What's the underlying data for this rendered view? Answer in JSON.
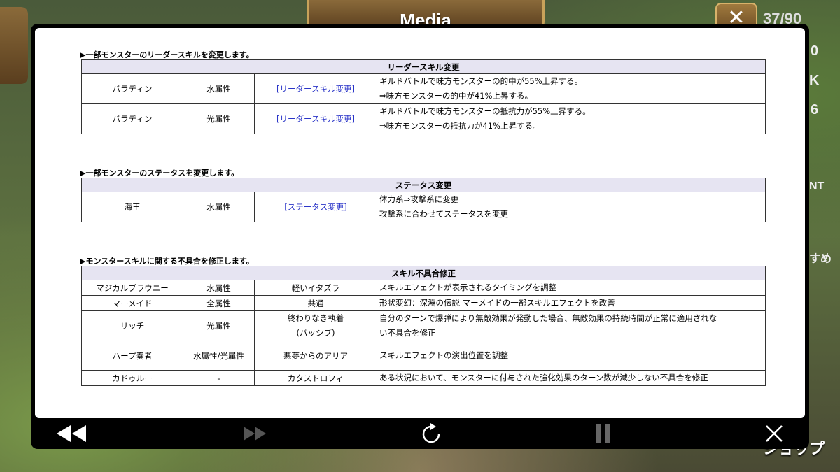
{
  "game": {
    "title": "Media",
    "counter": "37/90",
    "side_labels": [
      "0",
      "K",
      "6",
      "NT",
      "すめ"
    ],
    "shop_label": "ショップ"
  },
  "document": {
    "section1": {
      "heading": "▶一部モンスターのリーダースキルを変更します。",
      "table_title": "リーダースキル変更",
      "rows": [
        {
          "monster": "パラディン",
          "attribute": "水属性",
          "link": "[リーダースキル変更]",
          "line1": "ギルドバトルで味方モンスターの的中が55%上昇する。",
          "line2": "⇒味方モンスターの的中が41%上昇する。"
        },
        {
          "monster": "パラディン",
          "attribute": "光属性",
          "link": "[リーダースキル変更]",
          "line1": "ギルドバトルで味方モンスターの抵抗力が55%上昇する。",
          "line2": "⇒味方モンスターの抵抗力が41%上昇する。"
        }
      ]
    },
    "section2": {
      "heading": "▶一部モンスターのステータスを変更します。",
      "table_title": "ステータス変更",
      "rows": [
        {
          "monster": "海王",
          "attribute": "水属性",
          "link": "[ステータス変更]",
          "line1": "体力系⇒攻撃系に変更",
          "line2": "攻撃系に合わせてステータスを変更"
        }
      ]
    },
    "section3": {
      "heading": "▶モンスタースキルに関する不具合を修正します。",
      "table_title": "スキル不具合修正",
      "rows": [
        {
          "monster": "マジカルブラウニー",
          "attribute": "水属性",
          "skill": "軽いイタズラ",
          "desc": "スキルエフェクトが表示されるタイミングを調整"
        },
        {
          "monster": "マーメイド",
          "attribute": "全属性",
          "skill": "共通",
          "desc": "形状変幻：深淵の伝説 マーメイドの一部スキルエフェクトを改善"
        },
        {
          "monster": "リッチ",
          "attribute": "光属性",
          "skill": "終わりなき執着",
          "skill2": "(パッシブ)",
          "desc": "自分のターンで爆弾により無敵効果が発動した場合、無敵効果の持続時間が正常に適用されな",
          "desc2": "い不具合を修正"
        },
        {
          "monster": "ハープ奏者",
          "attribute": "水属性/光属性",
          "skill": "悪夢からのアリア",
          "desc": "スキルエフェクトの演出位置を調整"
        },
        {
          "monster": "カドゥルー",
          "attribute": "-",
          "skill": "カタストロフィ",
          "desc": "ある状況において、モンスターに付与された強化効果のターン数が減少しない不具合を修正"
        }
      ]
    }
  },
  "controls": {
    "rewind_icon": "rewind-icon",
    "forward_icon": "fast-forward-icon",
    "reload_icon": "reload-icon",
    "pause_icon": "pause-icon",
    "close_icon": "close-icon"
  }
}
